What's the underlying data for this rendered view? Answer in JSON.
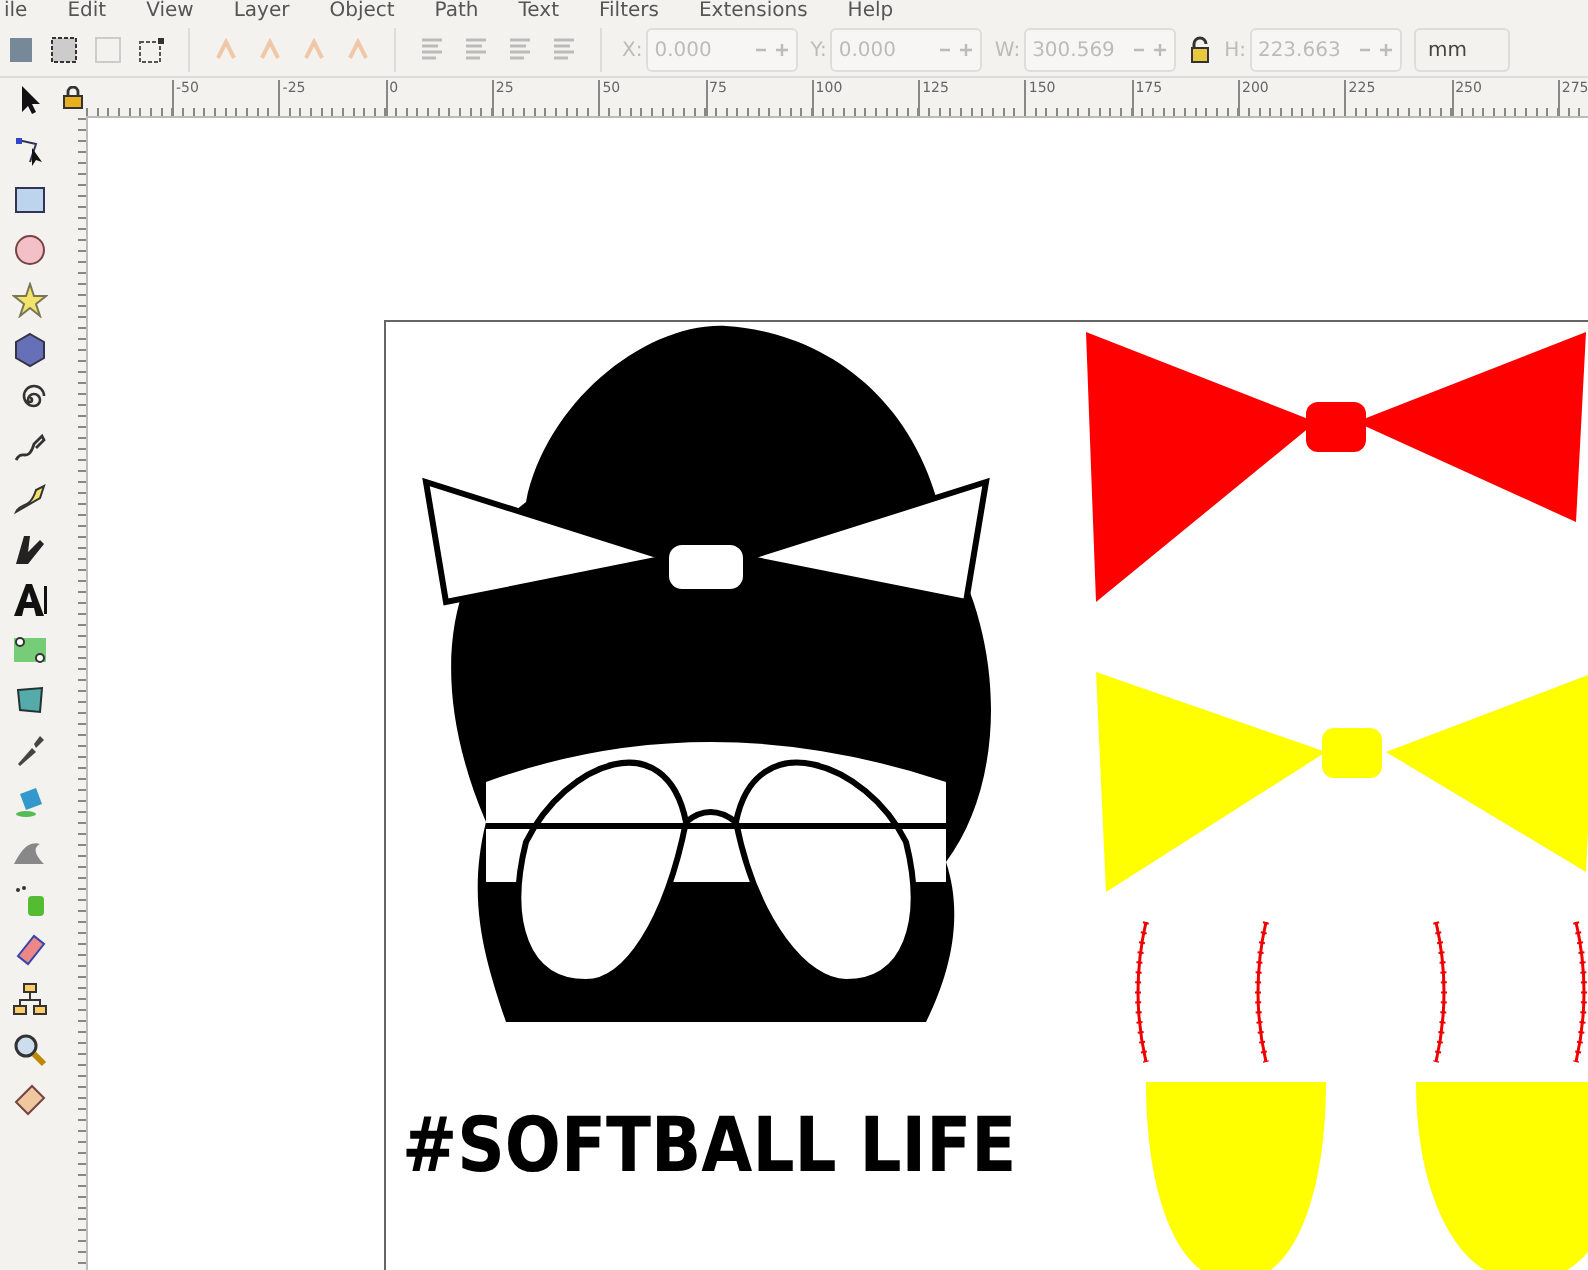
{
  "menu": [
    "ile",
    "Edit",
    "View",
    "Layer",
    "Object",
    "Path",
    "Text",
    "Filters",
    "Extensions",
    "Help"
  ],
  "fields": [
    {
      "label": "X:",
      "value": "0.000",
      "disabled": true
    },
    {
      "label": "Y:",
      "value": "0.000",
      "disabled": true
    },
    {
      "label": "W:",
      "value": "300.569",
      "disabled": true
    },
    {
      "label": "H:",
      "value": "223.663",
      "disabled": true
    }
  ],
  "unit": "mm",
  "ruler": [
    "-50",
    "-25",
    "0",
    "25",
    "50",
    "75",
    "100",
    "125",
    "150",
    "175",
    "200",
    "225",
    "250",
    "275"
  ],
  "artwork_text": "#SOFTBALL LIFE"
}
